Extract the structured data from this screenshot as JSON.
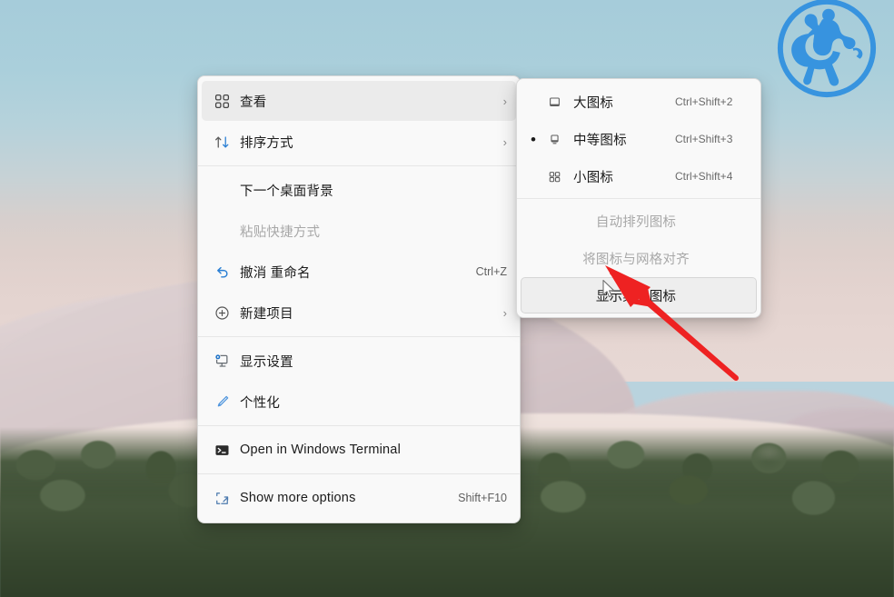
{
  "desktop": {
    "wallpaper_description": "Windows 11 mountain landscape wallpaper with pine forest",
    "logo_alt": "blue circular horse rider emblem watermark"
  },
  "context_menu": {
    "items": [
      {
        "id": "view",
        "label": "查看",
        "icon": "grid-icon",
        "accel": "",
        "submenu": true,
        "disabled": false,
        "highlighted": true
      },
      {
        "id": "sort-by",
        "label": "排序方式",
        "icon": "sort-icon",
        "accel": "",
        "submenu": true,
        "disabled": false,
        "highlighted": false
      },
      {
        "id": "separator-1",
        "type": "separator"
      },
      {
        "id": "next-wallpaper",
        "label": "下一个桌面背景",
        "icon": "",
        "accel": "",
        "submenu": false,
        "disabled": false,
        "highlighted": false
      },
      {
        "id": "paste-shortcut",
        "label": "粘贴快捷方式",
        "icon": "",
        "accel": "",
        "submenu": false,
        "disabled": true,
        "highlighted": false
      },
      {
        "id": "undo-rename",
        "label": "撤消 重命名",
        "icon": "undo-icon",
        "accel": "Ctrl+Z",
        "submenu": false,
        "disabled": false,
        "highlighted": false
      },
      {
        "id": "new-item",
        "label": "新建项目",
        "icon": "plus-circle-icon",
        "accel": "",
        "submenu": true,
        "disabled": false,
        "highlighted": false
      },
      {
        "id": "separator-2",
        "type": "separator"
      },
      {
        "id": "display-settings",
        "label": "显示设置",
        "icon": "monitor-icon",
        "accel": "",
        "submenu": false,
        "disabled": false,
        "highlighted": false
      },
      {
        "id": "personalize",
        "label": "个性化",
        "icon": "brush-icon",
        "accel": "",
        "submenu": false,
        "disabled": false,
        "highlighted": false
      },
      {
        "id": "separator-3",
        "type": "separator"
      },
      {
        "id": "open-terminal",
        "label": "Open in Windows Terminal",
        "icon": "terminal-icon",
        "accel": "",
        "submenu": false,
        "disabled": false,
        "highlighted": false
      },
      {
        "id": "separator-4",
        "type": "separator"
      },
      {
        "id": "show-more",
        "label": "Show more options",
        "icon": "more-options-icon",
        "accel": "Shift+F10",
        "submenu": false,
        "disabled": false,
        "highlighted": false
      }
    ]
  },
  "view_submenu": {
    "items": [
      {
        "id": "large-icons",
        "label": "大图标",
        "icon": "large-icon-glyph",
        "accel": "Ctrl+Shift+2",
        "checked": false,
        "disabled": false,
        "selected": false
      },
      {
        "id": "medium-icons",
        "label": "中等图标",
        "icon": "medium-icon-glyph",
        "accel": "Ctrl+Shift+3",
        "checked": true,
        "disabled": false,
        "selected": false
      },
      {
        "id": "small-icons",
        "label": "小图标",
        "icon": "small-icon-glyph",
        "accel": "Ctrl+Shift+4",
        "checked": false,
        "disabled": false,
        "selected": false
      },
      {
        "id": "separator-s1",
        "type": "separator"
      },
      {
        "id": "auto-arrange",
        "label": "自动排列图标",
        "icon": "",
        "accel": "",
        "checked": false,
        "disabled": true,
        "selected": false
      },
      {
        "id": "align-grid",
        "label": "将图标与网格对齐",
        "icon": "",
        "accel": "",
        "checked": false,
        "disabled": true,
        "selected": false
      },
      {
        "id": "show-desktop-icons",
        "label": "显示桌面图标",
        "icon": "",
        "accel": "",
        "checked": false,
        "disabled": false,
        "selected": true
      }
    ]
  },
  "annotation": {
    "arrow_color": "#ee2222",
    "arrow_target": "显示桌面图标",
    "cursor_name": "mouse-pointer"
  },
  "colors": {
    "menu_background": "#f9f9f9",
    "menu_highlight": "#ebebeb",
    "accent_blue": "#2a7fd4",
    "text_primary": "#1b1b1b",
    "text_disabled": "#a8a8a8",
    "sky_top": "#a6ccda",
    "forest_green": "#44553a"
  }
}
